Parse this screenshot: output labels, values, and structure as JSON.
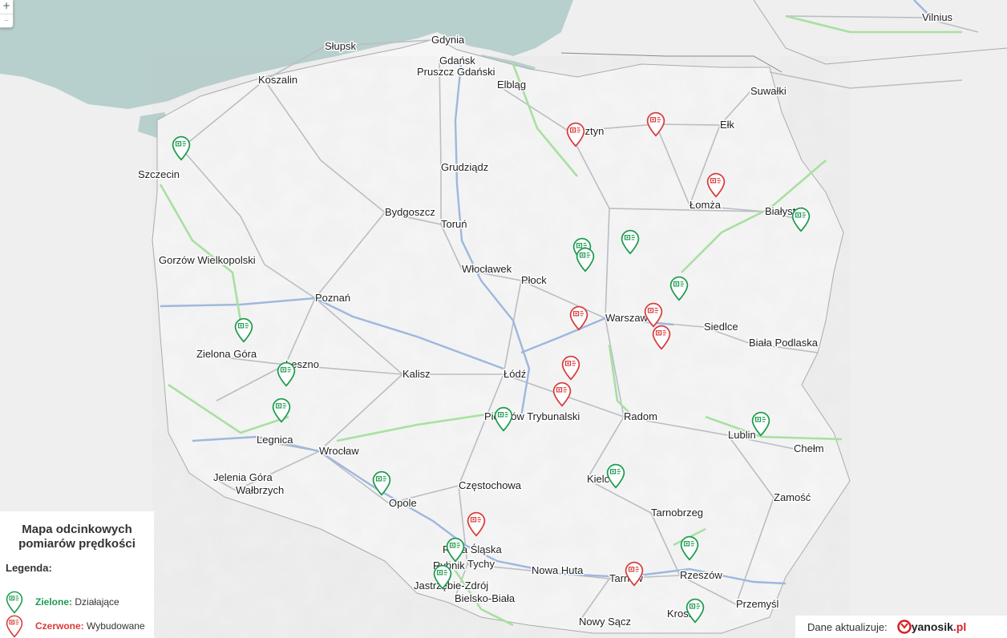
{
  "zoom": {
    "in_label": "+",
    "out_label": "–"
  },
  "cities": [
    {
      "name": "Vilnius",
      "pos": [
        1150,
        22
      ]
    },
    {
      "name": "Słupsk",
      "pos": [
        405,
        58
      ]
    },
    {
      "name": "Gdynia",
      "pos": [
        538,
        50
      ]
    },
    {
      "name": "Gdańsk",
      "pos": [
        548,
        76
      ]
    },
    {
      "name": "Pruszcz Gdański",
      "pos": [
        520,
        90
      ]
    },
    {
      "name": "Elbląg",
      "pos": [
        620,
        106
      ]
    },
    {
      "name": "Koszalin",
      "pos": [
        322,
        100
      ]
    },
    {
      "name": "Suwałki",
      "pos": [
        936,
        114
      ]
    },
    {
      "name": "Ełk",
      "pos": [
        898,
        156
      ]
    },
    {
      "name": "Olsztyn",
      "pos": [
        710,
        164
      ]
    },
    {
      "name": "Szczecin",
      "pos": [
        172,
        218
      ]
    },
    {
      "name": "Grudziądz",
      "pos": [
        550,
        209
      ]
    },
    {
      "name": "Łomża",
      "pos": [
        860,
        256
      ]
    },
    {
      "name": "Białystok",
      "pos": [
        954,
        264
      ]
    },
    {
      "name": "Bydgoszcz",
      "pos": [
        480,
        265
      ]
    },
    {
      "name": "Toruń",
      "pos": [
        550,
        280
      ]
    },
    {
      "name": "Gorzów Wielkopolski",
      "pos": [
        198,
        325
      ]
    },
    {
      "name": "Włocławek",
      "pos": [
        576,
        336
      ]
    },
    {
      "name": "Płock",
      "pos": [
        650,
        350
      ]
    },
    {
      "name": "Poznań",
      "pos": [
        393,
        372
      ]
    },
    {
      "name": "Warszawa",
      "pos": [
        755,
        397
      ]
    },
    {
      "name": "Siedlce",
      "pos": [
        878,
        408
      ]
    },
    {
      "name": "Biała Podlaska",
      "pos": [
        934,
        428
      ]
    },
    {
      "name": "Zielona Góra",
      "pos": [
        245,
        442
      ]
    },
    {
      "name": "Leszno",
      "pos": [
        356,
        455
      ]
    },
    {
      "name": "Kalisz",
      "pos": [
        502,
        467
      ]
    },
    {
      "name": "Łódź",
      "pos": [
        628,
        467
      ]
    },
    {
      "name": "Piotrków Trybunalski",
      "pos": [
        604,
        520
      ]
    },
    {
      "name": "Radom",
      "pos": [
        778,
        520
      ]
    },
    {
      "name": "Legnica",
      "pos": [
        320,
        549
      ]
    },
    {
      "name": "Lublin",
      "pos": [
        908,
        543
      ]
    },
    {
      "name": "Chełm",
      "pos": [
        990,
        560
      ]
    },
    {
      "name": "Wrocław",
      "pos": [
        398,
        563
      ]
    },
    {
      "name": "Jelenia Góra",
      "pos": [
        266,
        596
      ]
    },
    {
      "name": "Kielce",
      "pos": [
        732,
        598
      ]
    },
    {
      "name": "Częstochowa",
      "pos": [
        572,
        606
      ]
    },
    {
      "name": "Wałbrzych",
      "pos": [
        294,
        612
      ]
    },
    {
      "name": "Zamość",
      "pos": [
        965,
        621
      ]
    },
    {
      "name": "Opole",
      "pos": [
        485,
        628
      ]
    },
    {
      "name": "Tarnobrzeg",
      "pos": [
        812,
        640
      ]
    },
    {
      "name": "Ruda Śląska",
      "pos": [
        552,
        686
      ]
    },
    {
      "name": "Rybnik",
      "pos": [
        540,
        706
      ]
    },
    {
      "name": "Tychy",
      "pos": [
        583,
        704
      ]
    },
    {
      "name": "Nowa Huta",
      "pos": [
        663,
        712
      ]
    },
    {
      "name": "Tarnów",
      "pos": [
        760,
        722
      ]
    },
    {
      "name": "Rzeszów",
      "pos": [
        848,
        718
      ]
    },
    {
      "name": "Jastrzębie-Zdrój",
      "pos": [
        516,
        731
      ]
    },
    {
      "name": "Bielsko-Biała",
      "pos": [
        567,
        747
      ]
    },
    {
      "name": "Przemyśl",
      "pos": [
        918,
        754
      ]
    },
    {
      "name": "Nowy Sącz",
      "pos": [
        722,
        776
      ]
    },
    {
      "name": "Krosno",
      "pos": [
        832,
        766
      ]
    }
  ],
  "markers": [
    {
      "status": "green",
      "pos": [
        226,
        185
      ]
    },
    {
      "status": "red",
      "pos": [
        718,
        168
      ]
    },
    {
      "status": "red",
      "pos": [
        818,
        155
      ]
    },
    {
      "status": "red",
      "pos": [
        893,
        231
      ]
    },
    {
      "status": "green",
      "pos": [
        999,
        274
      ]
    },
    {
      "status": "green",
      "pos": [
        726,
        312
      ]
    },
    {
      "status": "green",
      "pos": [
        786,
        302
      ]
    },
    {
      "status": "green",
      "pos": [
        730,
        324
      ]
    },
    {
      "status": "green",
      "pos": [
        847,
        360
      ]
    },
    {
      "status": "red",
      "pos": [
        722,
        397
      ]
    },
    {
      "status": "red",
      "pos": [
        815,
        393
      ]
    },
    {
      "status": "red",
      "pos": [
        825,
        421
      ]
    },
    {
      "status": "green",
      "pos": [
        304,
        412
      ]
    },
    {
      "status": "green",
      "pos": [
        357,
        467
      ]
    },
    {
      "status": "red",
      "pos": [
        712,
        459
      ]
    },
    {
      "status": "red",
      "pos": [
        701,
        492
      ]
    },
    {
      "status": "green",
      "pos": [
        351,
        512
      ]
    },
    {
      "status": "green",
      "pos": [
        628,
        523
      ]
    },
    {
      "status": "green",
      "pos": [
        949,
        529
      ]
    },
    {
      "status": "green",
      "pos": [
        768,
        594
      ]
    },
    {
      "status": "green",
      "pos": [
        476,
        603
      ]
    },
    {
      "status": "red",
      "pos": [
        594,
        654
      ]
    },
    {
      "status": "green",
      "pos": [
        568,
        686
      ]
    },
    {
      "status": "green",
      "pos": [
        860,
        684
      ]
    },
    {
      "status": "red",
      "pos": [
        791,
        716
      ]
    },
    {
      "status": "green",
      "pos": [
        552,
        720
      ]
    },
    {
      "status": "green",
      "pos": [
        867,
        762
      ]
    }
  ],
  "legend": {
    "title_line1": "Mapa odcinkowych",
    "title_line2": "pomiarów prędkości",
    "heading": "Legenda:",
    "green_label": "Zielone:",
    "green_desc": "Działające",
    "red_label": "Czerwone:",
    "red_desc": "Wybudowane"
  },
  "credit": {
    "text": "Dane aktualizuje:",
    "brand_main": "yanosik",
    "brand_suffix": ".pl"
  },
  "colors": {
    "green": "#1e9a4f",
    "red": "#d83b3b",
    "sea": "#b7cfcd",
    "land": "#f4f4f4"
  }
}
